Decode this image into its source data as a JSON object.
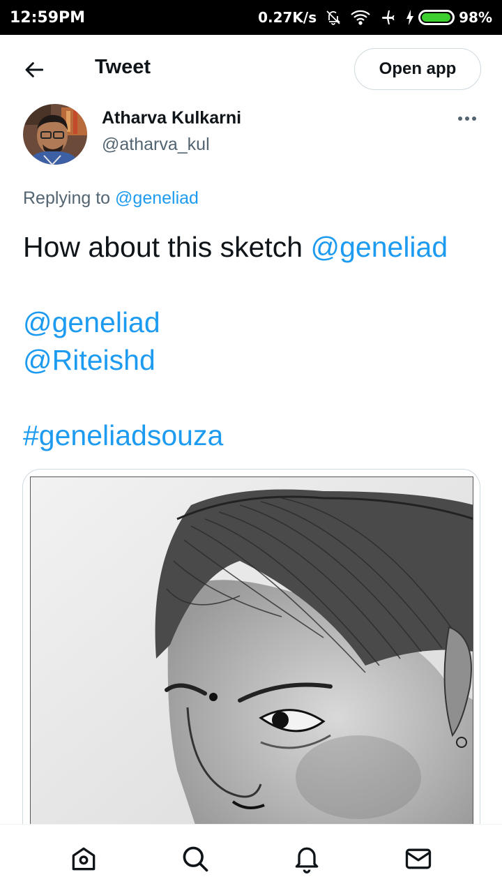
{
  "status_bar": {
    "time": "12:59PM",
    "network_speed": "0.27K/s",
    "battery_percent": "98%",
    "battery_level": 0.98,
    "battery_color": "#3ccf2f",
    "icons": [
      "bell-off-icon",
      "wifi-icon",
      "airplane-icon",
      "charging-icon",
      "battery-icon"
    ]
  },
  "header": {
    "title": "Tweet",
    "open_app_label": "Open app",
    "back_icon": "arrow-left-icon"
  },
  "tweet": {
    "author_name": "Atharva Kulkarni",
    "author_handle": "@atharva_kul",
    "replying_prefix": "Replying to",
    "replying_to": "@geneliad",
    "line1_text": "How about this sketch ",
    "line1_mention": "@geneliad",
    "mention2": "@geneliad",
    "mention3": "@Riteishd",
    "hashtag": "#geneliadsouza",
    "media_icon": "pencil-sketch-image"
  },
  "bottom_nav": {
    "items": [
      "home-icon",
      "search-icon",
      "notifications-icon",
      "messages-icon"
    ]
  },
  "colors": {
    "accent": "#1d9bf0",
    "text": "#0f1419",
    "secondary": "#536471",
    "border": "#cfd9de"
  }
}
